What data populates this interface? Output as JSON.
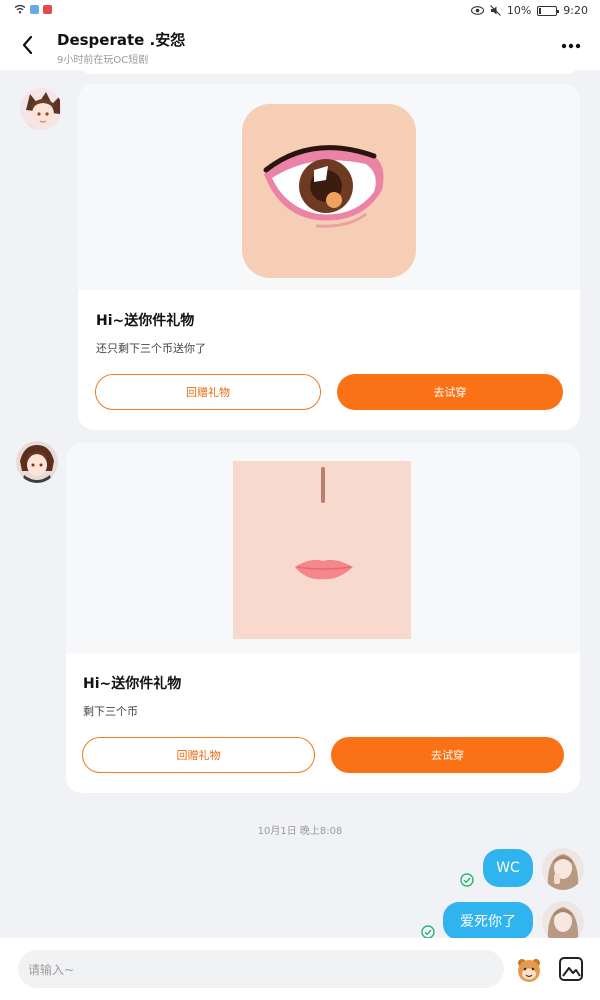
{
  "status_bar": {
    "battery_text": "10%",
    "time": "9:20",
    "battery_level": 0.1,
    "left_icons": [
      "wifi-icon",
      "app-notification-icon",
      "app-notification-icon"
    ],
    "right_icons": [
      "eye-icon",
      "mute-icon",
      "battery-icon"
    ]
  },
  "header": {
    "title": "Desperate .安怨",
    "subtitle": "9小时前在玩OC短剧",
    "back_icon": "chevron-left-icon",
    "more_icon": "more-horizontal-icon"
  },
  "messages": [
    {
      "type": "gift",
      "sender": "other",
      "gift_image": "eye-makeup-item",
      "title": "Hi~送你件礼物",
      "text": "还只剩下三个币送你了",
      "return_gift_label": "回赠礼物",
      "try_on_label": "去试穿"
    },
    {
      "type": "gift",
      "sender": "other",
      "gift_image": "face-nose-lips-item",
      "title": "Hi~送你件礼物",
      "text": "剩下三个币",
      "return_gift_label": "回赠礼物",
      "try_on_label": "去试穿"
    }
  ],
  "timestamp": "10月1日 晚上8:08",
  "own_messages": [
    {
      "text": "WC",
      "status": "sent"
    },
    {
      "text": "爱死你了",
      "status": "sent"
    }
  ],
  "input": {
    "placeholder": "请输入~"
  },
  "colors": {
    "accent_orange": "#fb7216",
    "bubble_blue": "#2fb4f0",
    "check_green": "#2bb673"
  }
}
